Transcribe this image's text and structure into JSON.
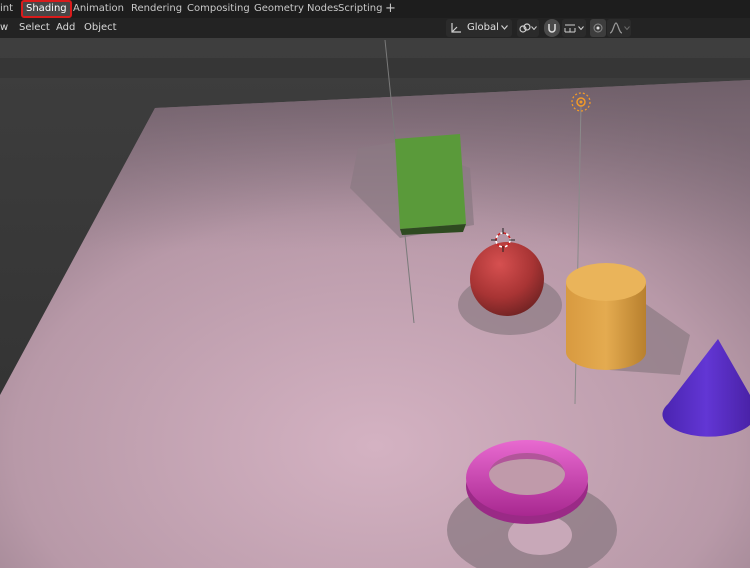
{
  "workspace_tabs": {
    "layout_partial": "int",
    "shading": "Shading",
    "animation": "Animation",
    "rendering": "Rendering",
    "compositing": "Compositing",
    "geometry_nodes": "Geometry Nodes",
    "scripting": "Scripting",
    "add": "+"
  },
  "viewport_header": {
    "view_partial": "w",
    "select": "Select",
    "add": "Add",
    "object": "Object",
    "transform_orientation": "Global"
  },
  "scene": {
    "objects": [
      {
        "name": "cube",
        "color": "#5a9a3a"
      },
      {
        "name": "sphere",
        "color": "#b83c3c"
      },
      {
        "name": "cylinder",
        "color": "#e0a848"
      },
      {
        "name": "cone",
        "color": "#5a2ec8"
      },
      {
        "name": "torus",
        "color": "#d83cb8"
      }
    ],
    "floor_color": "#c8a8b8",
    "light_icon": "sun-light-icon",
    "cursor_icon": "3d-cursor-icon"
  }
}
